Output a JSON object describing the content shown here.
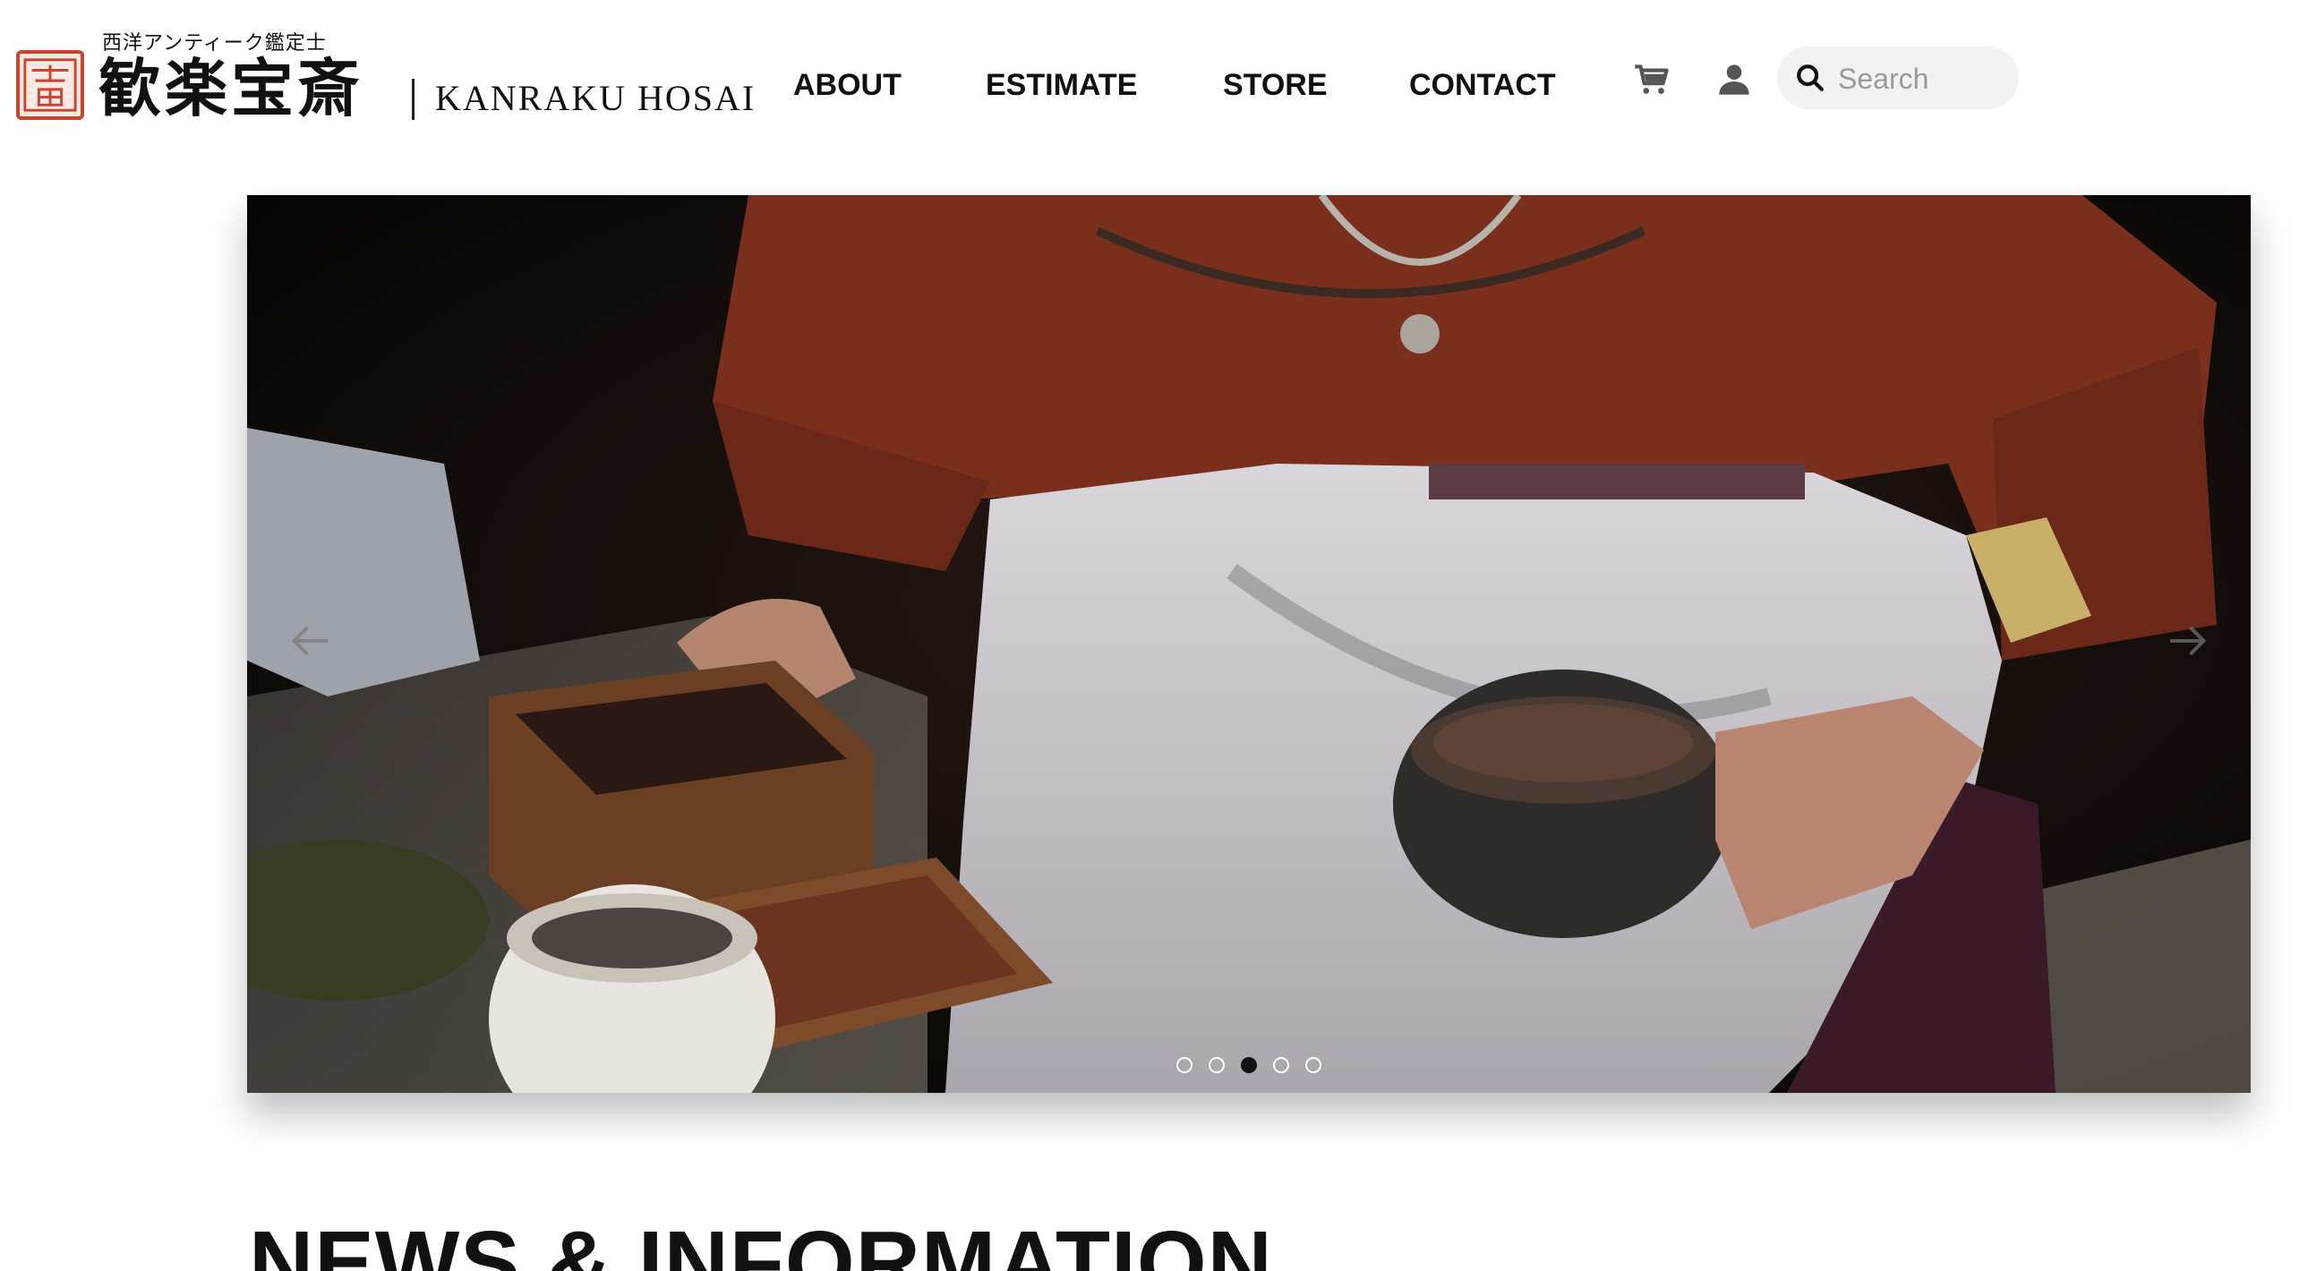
{
  "brand": {
    "subtitle": "西洋アンティーク鑑定士",
    "kanji_name": "歓楽宝斎",
    "romaji_name": "KANRAKU HOSAI",
    "seal_icon": "seal-stamp-icon",
    "seal_color": "#c8452f"
  },
  "nav": {
    "items": [
      {
        "label": "ABOUT"
      },
      {
        "label": "ESTIMATE"
      },
      {
        "label": "STORE"
      },
      {
        "label": "CONTACT"
      }
    ],
    "cart_icon": "cart-icon",
    "account_icon": "user-icon"
  },
  "search": {
    "placeholder": "Search",
    "value": "",
    "icon": "search-icon"
  },
  "carousel": {
    "slide_count": 5,
    "active_slide": 3,
    "prev_icon": "arrow-left-icon",
    "next_icon": "arrow-right-icon",
    "image_alt": "Woman in rust-red tunic grinding spices in a stone mortar beside wooden boxes of powder and herbs"
  },
  "section": {
    "title": "NEWS & INFORMATION"
  }
}
